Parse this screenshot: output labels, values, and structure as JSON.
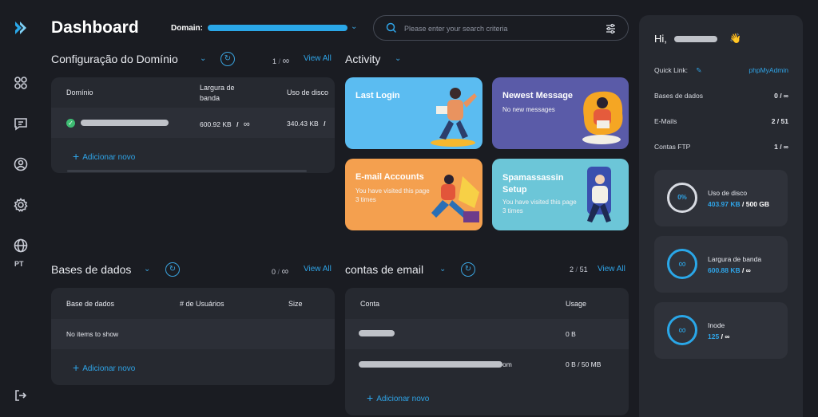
{
  "header": {
    "title": "Dashboard",
    "domain_label": "Domain:",
    "search_placeholder": "Please enter your search criteria"
  },
  "sidebar": {
    "items": [
      {
        "icon": "logo-icon"
      },
      {
        "icon": "apps-grid-icon"
      },
      {
        "icon": "chat-icon"
      },
      {
        "icon": "user-circle-icon"
      },
      {
        "icon": "settings-gear-icon"
      },
      {
        "icon": "globe-icon",
        "label": "PT"
      },
      {
        "icon": "logout-icon"
      }
    ],
    "lang": "PT"
  },
  "domain_config": {
    "title": "Configuração do Domínio",
    "count": "1",
    "sep": "/",
    "limit": "∞",
    "view_all": "View All",
    "columns": [
      "Domínio",
      "Largura de banda",
      "Uso de disco"
    ],
    "row": {
      "bandwidth": "600.92 KB",
      "bw_sep": "/",
      "bw_limit": "∞",
      "disk": "340.43 KB",
      "disk_sep": "/"
    },
    "add_new": "Adicionar novo"
  },
  "activity": {
    "title": "Activity",
    "cards": [
      {
        "title": "Last Login",
        "subtitle": "",
        "color": "#5bbcf1"
      },
      {
        "title": "Newest Message",
        "subtitle": "No new messages",
        "color": "#5a5ba8"
      },
      {
        "title": "E-mail Accounts",
        "subtitle": "You have visited this page 3 times",
        "color": "#f4a04f"
      },
      {
        "title": "Spamassassin Setup",
        "subtitle": "You have visited this page 3 times",
        "color": "#6cc6d8"
      }
    ]
  },
  "databases": {
    "title": "Bases de dados",
    "count": "0",
    "sep": "/",
    "limit": "∞",
    "view_all": "View All",
    "columns": [
      "Base de dados",
      "# de Usuários",
      "Size"
    ],
    "empty": "No items to show",
    "add_new": "Adicionar novo"
  },
  "email": {
    "title": "contas de email",
    "count": "2",
    "sep": "/",
    "limit": "51",
    "view_all": "View All",
    "columns": [
      "Conta",
      "Usage"
    ],
    "rows": [
      {
        "account_suffix": "",
        "usage": "0 B"
      },
      {
        "account_suffix": "om",
        "usage": "0 B / 50 MB"
      }
    ],
    "add_new": "Adicionar novo"
  },
  "right_panel": {
    "greeting": "Hi,",
    "wave": "👋",
    "quick_link_label": "Quick Link:",
    "quick_link_value": "phpMyAdmin",
    "stats_rows": [
      {
        "label": "Bases de dados",
        "value": "0 / ∞"
      },
      {
        "label": "E-Mails",
        "value": "2 / 51"
      },
      {
        "label": "Contas FTP",
        "value": "1 / ∞"
      }
    ],
    "disk": {
      "label": "Uso de disco",
      "ring": "0%",
      "used": "403.97 KB",
      "sep": "/",
      "total": "500 GB",
      "percent": 0
    },
    "bandwidth": {
      "label": "Largura de banda",
      "ring": "∞",
      "used": "600.88 KB",
      "sep": "/",
      "total": "∞"
    },
    "inode": {
      "label": "Inode",
      "ring": "∞",
      "used": "125",
      "sep": "/",
      "total": "∞"
    }
  },
  "colors": {
    "accent": "#2fa4e7",
    "background": "#1a1c22",
    "card": "#262930"
  }
}
